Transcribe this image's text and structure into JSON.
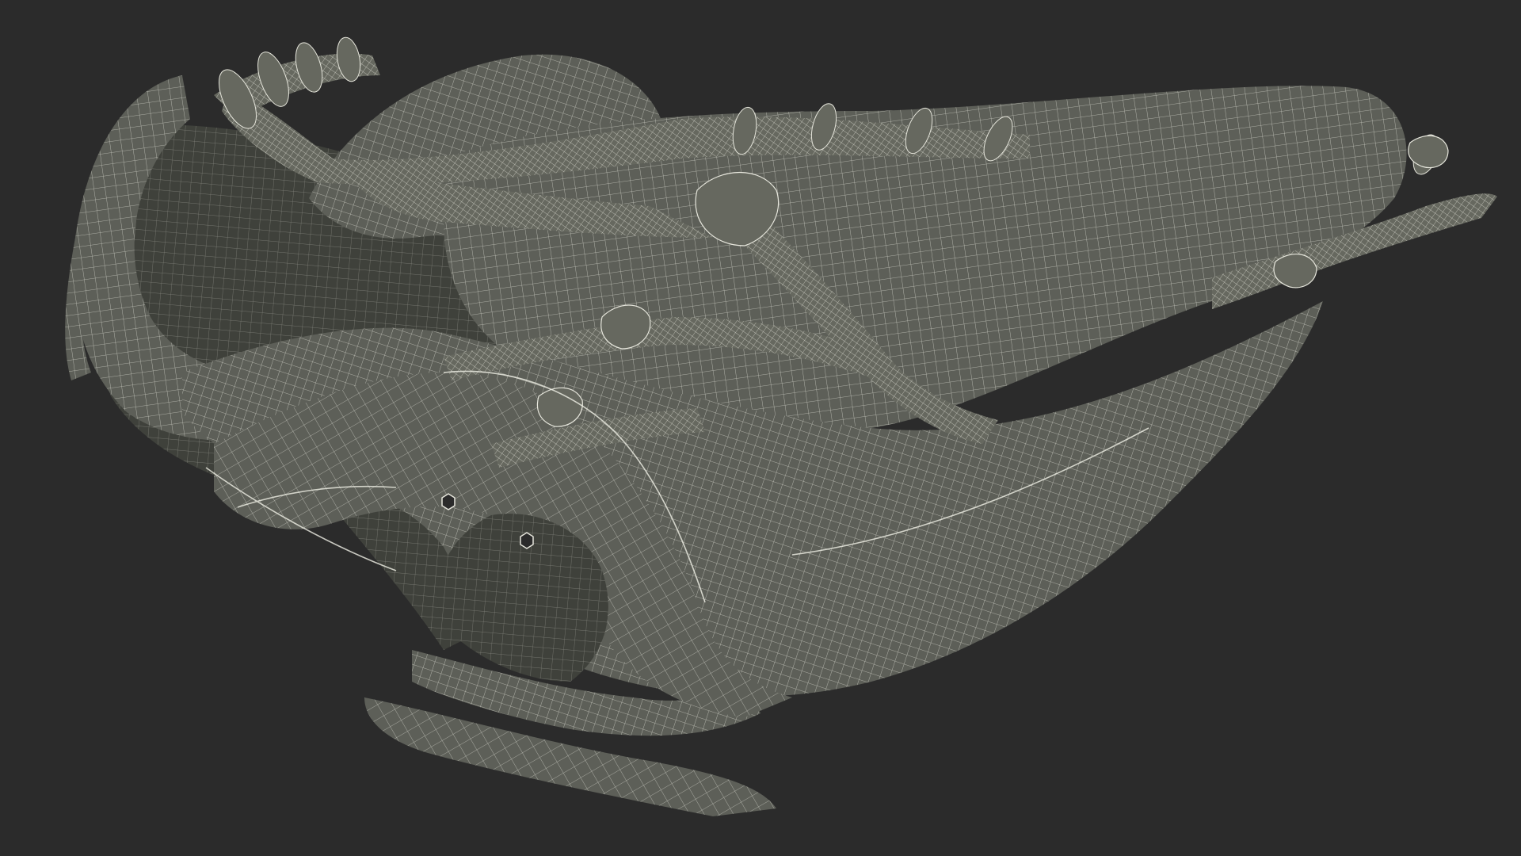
{
  "scene": {
    "subject": "wireframe-baseball-glove",
    "background_color": "#2b2b2b",
    "mesh_fill_color": "#5d5f58",
    "mesh_shadow_color": "#3f413b",
    "mesh_line_color": "#e6e6dc",
    "lace_fill_color": "#66685f"
  }
}
